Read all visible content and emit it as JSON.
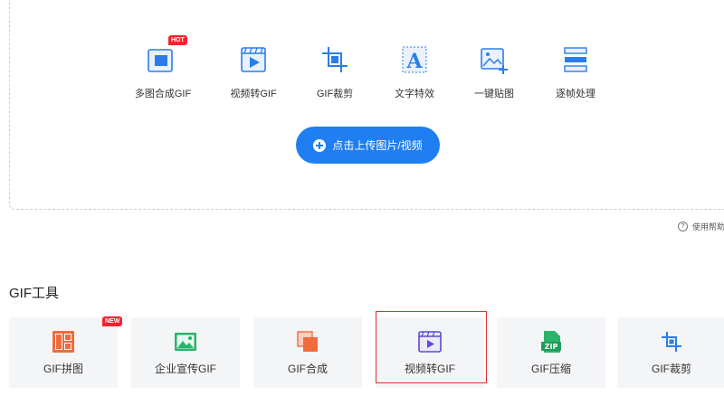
{
  "features": [
    {
      "label": "多图合成GIF",
      "icon": "multi-image-merge-icon",
      "badge": "HOT"
    },
    {
      "label": "视频转GIF",
      "icon": "video-to-gif-icon"
    },
    {
      "label": "GIF裁剪",
      "icon": "crop-icon"
    },
    {
      "label": "文字特效",
      "icon": "text-effect-icon"
    },
    {
      "label": "一键贴图",
      "icon": "sticker-icon"
    },
    {
      "label": "逐帧处理",
      "icon": "frame-by-frame-icon"
    }
  ],
  "upload": {
    "label": "点击上传图片/视频",
    "icon": "plus-circle-icon"
  },
  "help": {
    "label": "使用帮助",
    "icon": "question-circle-icon"
  },
  "tools": {
    "title": "GIF工具",
    "items": [
      {
        "label": "GIF拼图",
        "icon": "grid-collage-icon",
        "badge": "NEW"
      },
      {
        "label": "企业宣传GIF",
        "icon": "landscape-image-icon"
      },
      {
        "label": "GIF合成",
        "icon": "layers-merge-icon"
      },
      {
        "label": "视频转GIF",
        "icon": "video-to-gif-icon",
        "selected": true
      },
      {
        "label": "GIF压缩",
        "icon": "zip-file-icon"
      },
      {
        "label": "GIF裁剪",
        "icon": "crop-icon"
      }
    ]
  },
  "colors": {
    "accent": "#1f7ff2",
    "badge": "#f5222d",
    "selection": "#e52f2f",
    "card_bg": "#f4f5f7"
  }
}
